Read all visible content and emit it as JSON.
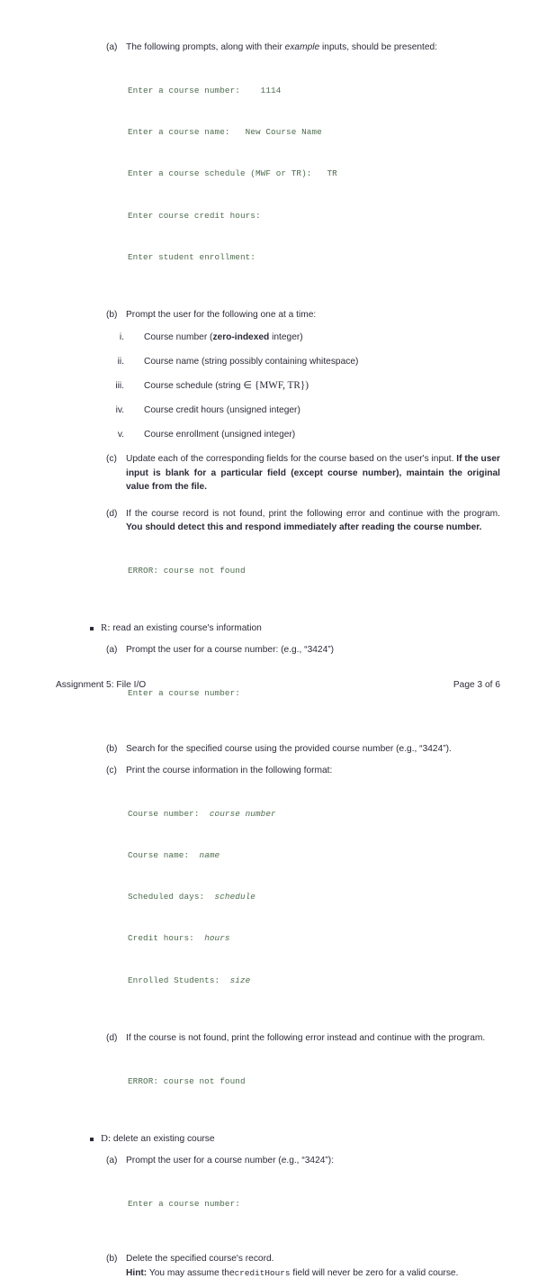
{
  "document": {
    "footer_left": "Assignment 5: File I/O",
    "footer_right": "Page 3 of 6"
  },
  "colors": {
    "code_green": "#4d6b4e",
    "body_text": "#2b2b38",
    "page_background": "#ffffff"
  },
  "sections": {
    "update": {
      "items": {
        "a": {
          "marker": "(a)",
          "text_before": "The following prompts, along with their ",
          "text_italic": "example",
          "text_after": " inputs, should be presented:",
          "code": [
            "Enter a course number:    1114",
            "Enter a course name:   New Course Name",
            "Enter a course schedule (MWF or TR):   TR",
            "Enter course credit hours:",
            "Enter student enrollment:"
          ]
        },
        "b": {
          "marker": "(b)",
          "text": "Prompt the user for the following one at a time:",
          "sub_items": [
            {
              "marker": "i.",
              "prefix": "Course number (",
              "bold": "zero-indexed",
              "suffix": " integer)"
            },
            {
              "marker": "ii.",
              "prefix": "Course name (string possibly containing whitespace)",
              "bold": "",
              "suffix": ""
            },
            {
              "marker": "iii.",
              "prefix": "Course schedule (string ",
              "bold": "",
              "suffix": "",
              "math": "∈ {MWF, TR})"
            },
            {
              "marker": "iv.",
              "prefix": "Course credit hours (unsigned integer)",
              "bold": "",
              "suffix": ""
            },
            {
              "marker": "v.",
              "prefix": "Course enrollment (unsigned integer)",
              "bold": "",
              "suffix": ""
            }
          ]
        },
        "c": {
          "marker": "(c)",
          "text_normal": "Update each of the corresponding fields for the course based on the user's input. ",
          "text_bold": "If the user input is blank for a particular field (except course number), maintain the original value from the file."
        },
        "d": {
          "marker": "(d)",
          "text_normal": "If the course record is not found, print the following error and continue with the program. ",
          "text_bold": "You should detect this and respond immediately after reading the course number.",
          "code": [
            "ERROR: course not found"
          ]
        }
      }
    },
    "read": {
      "bullet_label": "R:",
      "bullet_text": " read an existing course's information",
      "items": {
        "a": {
          "marker": "(a)",
          "text": "Prompt the user for a course number: (e.g., “3424”)",
          "code": [
            "Enter a course number:"
          ]
        },
        "b": {
          "marker": "(b)",
          "text": "Search for the specified course using the provided course number (e.g., “3424”)."
        },
        "c": {
          "marker": "(c)",
          "text": "Print the course information in the following format:",
          "code_pairs": [
            {
              "label": "Course number:  ",
              "value": "course number"
            },
            {
              "label": "Course name:  ",
              "value": "name"
            },
            {
              "label": "Scheduled days:  ",
              "value": "schedule"
            },
            {
              "label": "Credit hours:  ",
              "value": "hours"
            },
            {
              "label": "Enrolled Students:  ",
              "value": "size"
            }
          ]
        },
        "d": {
          "marker": "(d)",
          "text": "If the course is not found, print the following error instead and continue with the program.",
          "code": [
            "ERROR: course not found"
          ]
        }
      }
    },
    "delete": {
      "bullet_label": "D:",
      "bullet_text": " delete an existing course",
      "items": {
        "a": {
          "marker": "(a)",
          "text": "Prompt the user for a course number (e.g., “3424”):",
          "code": [
            "Enter a course number:"
          ]
        },
        "b": {
          "marker": "(b)",
          "text": "Delete the specified course's record.",
          "hint_label": "Hint:",
          "hint_before": " You may assume the",
          "hint_code": "creditHours",
          "hint_after": " field will never be zero for a valid course."
        }
      }
    }
  }
}
